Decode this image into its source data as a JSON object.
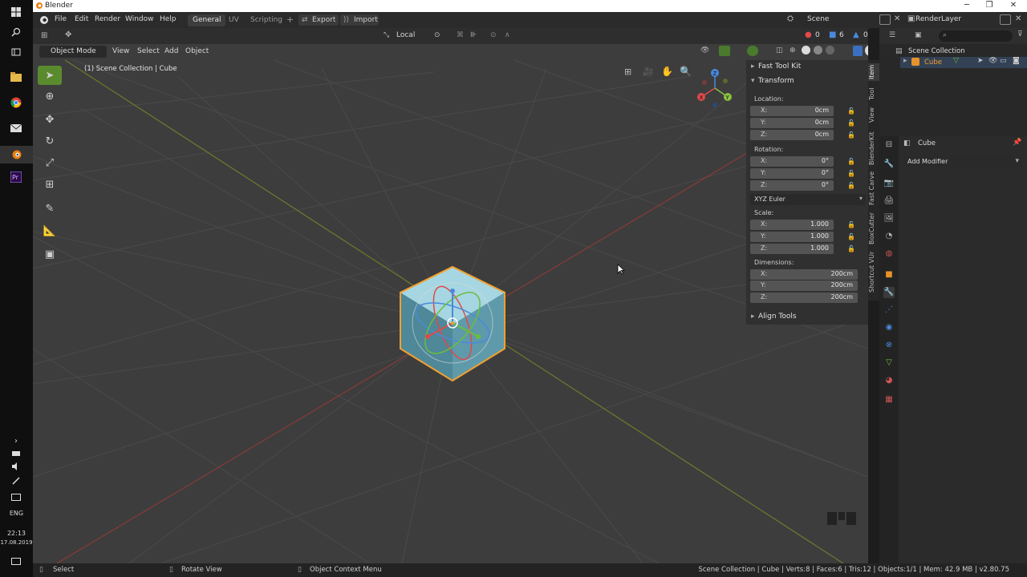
{
  "window": {
    "title": "Blender",
    "minimize": "─",
    "maximize": "❐",
    "close": "✕"
  },
  "taskbar": {
    "language": "ENG",
    "time": "22:13",
    "date": "17.08.2019",
    "icons": [
      "windows-start-icon",
      "search-icon",
      "task-view-icon",
      "file-explorer-icon",
      "chrome-icon",
      "mail-icon",
      "blender-icon",
      "premiere-icon"
    ]
  },
  "menubar": {
    "menus": [
      "File",
      "Edit",
      "Render",
      "Window",
      "Help"
    ],
    "workspaces": [
      "General",
      "UV",
      "Scripting"
    ],
    "add_workspace": "+",
    "export_label": "Export",
    "import_label": "Import",
    "scene_label": "Scene",
    "view_layer_label": "RenderLayer"
  },
  "viewport": {
    "mode_label": "Object Mode",
    "menus": [
      "View",
      "Select",
      "Add",
      "Object"
    ],
    "orientation_label": "Local",
    "breadcrumb": "(1) Scene Collection | Cube",
    "stats": {
      "a": "0",
      "b": "6",
      "c": "0"
    },
    "gizmo": {
      "x": "X",
      "y": "Y",
      "z": "Z"
    }
  },
  "npanel": {
    "fast_tool_kit": "Fast Tool Kit",
    "transform": "Transform",
    "location_label": "Location:",
    "location": [
      {
        "axis": "X:",
        "value": "0cm"
      },
      {
        "axis": "Y:",
        "value": "0cm"
      },
      {
        "axis": "Z:",
        "value": "0cm"
      }
    ],
    "rotation_label": "Rotation:",
    "rotation": [
      {
        "axis": "X:",
        "value": "0°"
      },
      {
        "axis": "Y:",
        "value": "0°"
      },
      {
        "axis": "Z:",
        "value": "0°"
      }
    ],
    "rotation_mode": "XYZ Euler",
    "scale_label": "Scale:",
    "scale": [
      {
        "axis": "X:",
        "value": "1.000"
      },
      {
        "axis": "Y:",
        "value": "1.000"
      },
      {
        "axis": "Z:",
        "value": "1.000"
      }
    ],
    "dimensions_label": "Dimensions:",
    "dimensions": [
      {
        "axis": "X:",
        "value": "200cm"
      },
      {
        "axis": "Y:",
        "value": "200cm"
      },
      {
        "axis": "Z:",
        "value": "200cm"
      }
    ],
    "align_tools": "Align Tools",
    "tabs": [
      "Item",
      "Tool",
      "View",
      "BlenderKit",
      "Fast Carve",
      "BoxCutter",
      "Shortcut VUr"
    ]
  },
  "outliner": {
    "root": "Scene Collection",
    "object": "Cube"
  },
  "properties": {
    "object_name": "Cube",
    "add_modifier": "Add Modifier"
  },
  "statusbar": {
    "select": "Select",
    "rotate_view": "Rotate View",
    "context_menu": "Object Context Menu",
    "info": "Scene Collection | Cube | Verts:8 | Faces:6 | Tris:12 | Objects:1/1 | Mem: 42.9 MB | v2.80.75"
  }
}
